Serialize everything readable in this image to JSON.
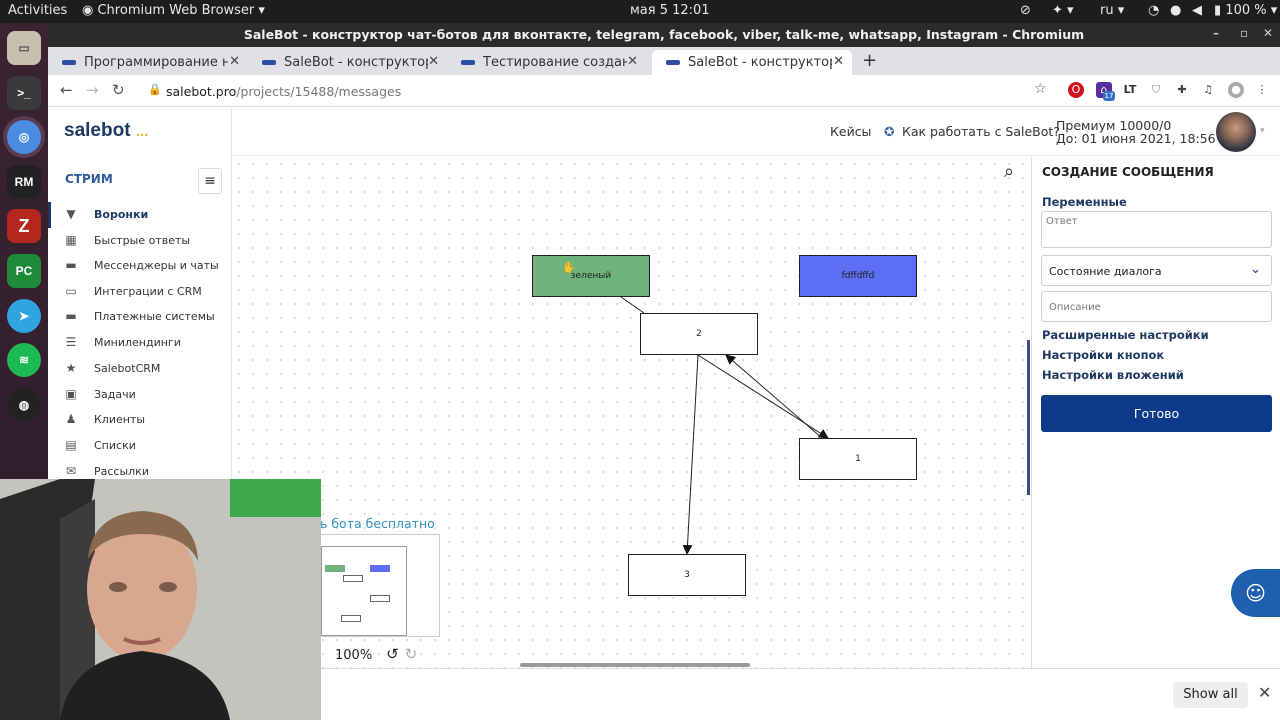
{
  "system_bar": {
    "activities": "Activities",
    "app_name": "Chromium Web Browser",
    "datetime": "мая 5  12:01",
    "language": "ru",
    "battery": "100 %"
  },
  "window": {
    "title": "SaleBot - конструктор чат-ботов для вконтакте, telegram, facebook, viber, talk-me, whatsapp, Instagram - Chromium"
  },
  "tabs": [
    {
      "label": "Программирование на"
    },
    {
      "label": "SaleBot - конструктор ч"
    },
    {
      "label": "Тестирование созданн"
    },
    {
      "label": "SaleBot - конструктор ч"
    }
  ],
  "address": {
    "host": "salebot.pro",
    "path": "/projects/15488/messages"
  },
  "extensions": {
    "badge_count": "17"
  },
  "sidebar": {
    "logo": "salebot",
    "logo_dots": "...",
    "section": "СТРИМ",
    "items": [
      {
        "label": "Воронки",
        "icon": "filter-icon"
      },
      {
        "label": "Быстрые ответы",
        "icon": "quick-reply-icon"
      },
      {
        "label": "Мессенджеры и чаты",
        "icon": "chat-icon"
      },
      {
        "label": "Интеграции с CRM",
        "icon": "crm-icon"
      },
      {
        "label": "Платежные системы",
        "icon": "card-icon"
      },
      {
        "label": "Минилендинги",
        "icon": "list-icon"
      },
      {
        "label": "SalebotCRM",
        "icon": "star-icon"
      },
      {
        "label": "Задачи",
        "icon": "briefcase-icon"
      },
      {
        "label": "Клиенты",
        "icon": "users-icon"
      },
      {
        "label": "Списки",
        "icon": "lists-icon"
      },
      {
        "label": "Рассылки",
        "icon": "mail-icon"
      }
    ]
  },
  "header": {
    "cases": "Кейсы",
    "how_it_works": "Как работать с SaleBot?",
    "plan": "Премиум 10000/0",
    "until": "До: 01 июня 2021, 18:56"
  },
  "canvas": {
    "nodes": [
      {
        "label": "зеленый",
        "color": "#6fb37a"
      },
      {
        "label": "fdffdffd",
        "color": "#5b6ef5"
      },
      {
        "label": "2"
      },
      {
        "label": "1"
      },
      {
        "label": "3"
      }
    ],
    "free_bot_text": "ь бота бесплатно",
    "zoom": "100%"
  },
  "right_panel": {
    "title": "СОЗДАНИЕ СООБЩЕНИЯ",
    "variables": "Переменные",
    "answer_placeholder": "Ответ",
    "dialog_state": "Состояние диалога",
    "description_placeholder": "Описание",
    "advanced": "Расширенные настройки",
    "buttons_settings": "Настройки кнопок",
    "attachments_settings": "Настройки вложений",
    "done": "Готово"
  },
  "downloads_bar": {
    "show_all": "Show all"
  },
  "colors": {
    "brand_dark": "#1e3a63",
    "primary_button": "#0d3a8a",
    "green_node": "#6fb37a",
    "blue_node": "#5b6ef5"
  }
}
